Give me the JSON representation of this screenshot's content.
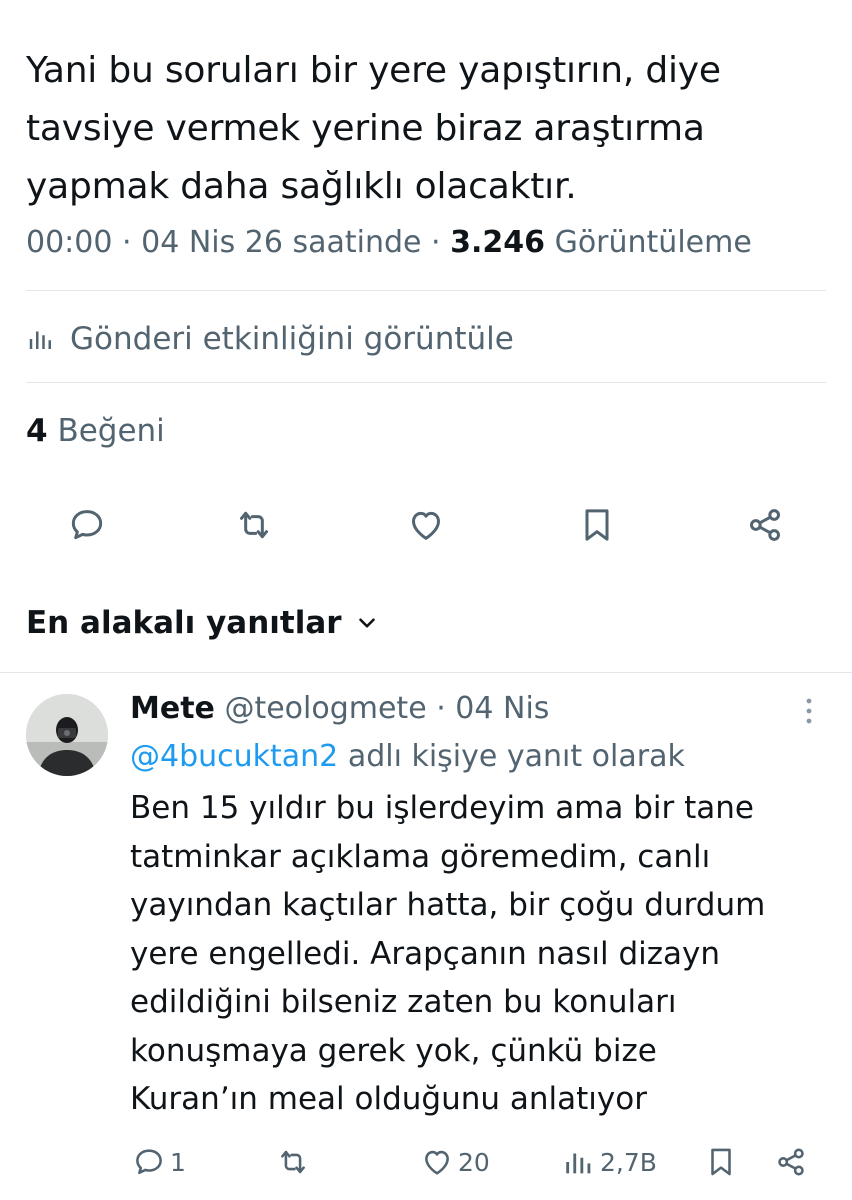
{
  "tweet": {
    "text_lines": [
      "Yani bu soruları bir yere yapıştırın, diye",
      "tavsiye vermek yerine biraz araştırma",
      "yapmak daha sağlıklı olacaktır."
    ],
    "time": "00:00",
    "date": "04 Nis 26 saatinde",
    "views_count": "3.246",
    "views_label": "Görüntüleme",
    "separator": "·",
    "activity_label": "Gönderi etkinliğini görüntüle",
    "likes_count": "4",
    "likes_label": "Beğeni"
  },
  "actions": [
    "reply-icon",
    "retweet-icon",
    "like-icon",
    "bookmark-icon",
    "share-icon"
  ],
  "replies_header": {
    "label": "En alakalı yanıtlar",
    "icon": "chevron-down-icon"
  },
  "reply": {
    "name": "Mete",
    "handle": "@teologmete",
    "date": "04 Nis",
    "separator": "·",
    "reply_to_handle": "@4bucuktan2",
    "reply_to_suffix": "adlı kişiye yanıt olarak",
    "text_lines": [
      "Ben 15 yıldır bu işlerdeyim ama bir tane",
      "tatminkar açıklama göremedim, canlı",
      "yayından kaçtılar hatta, bir çoğu durdum",
      "yere engelledi. Arapçanın nasıl dizayn",
      "edildiğini bilseniz zaten bu konuları",
      "konuşmaya gerek yok, çünkü bize",
      "Kuran’ın meal olduğunu anlatıyor"
    ],
    "reply_count": "1",
    "like_count": "20",
    "view_count": "2,7B"
  },
  "colors": {
    "text": "#0f1419",
    "secondary": "#536471",
    "link": "#1d9bf0",
    "divider": "#e1e6ea"
  }
}
